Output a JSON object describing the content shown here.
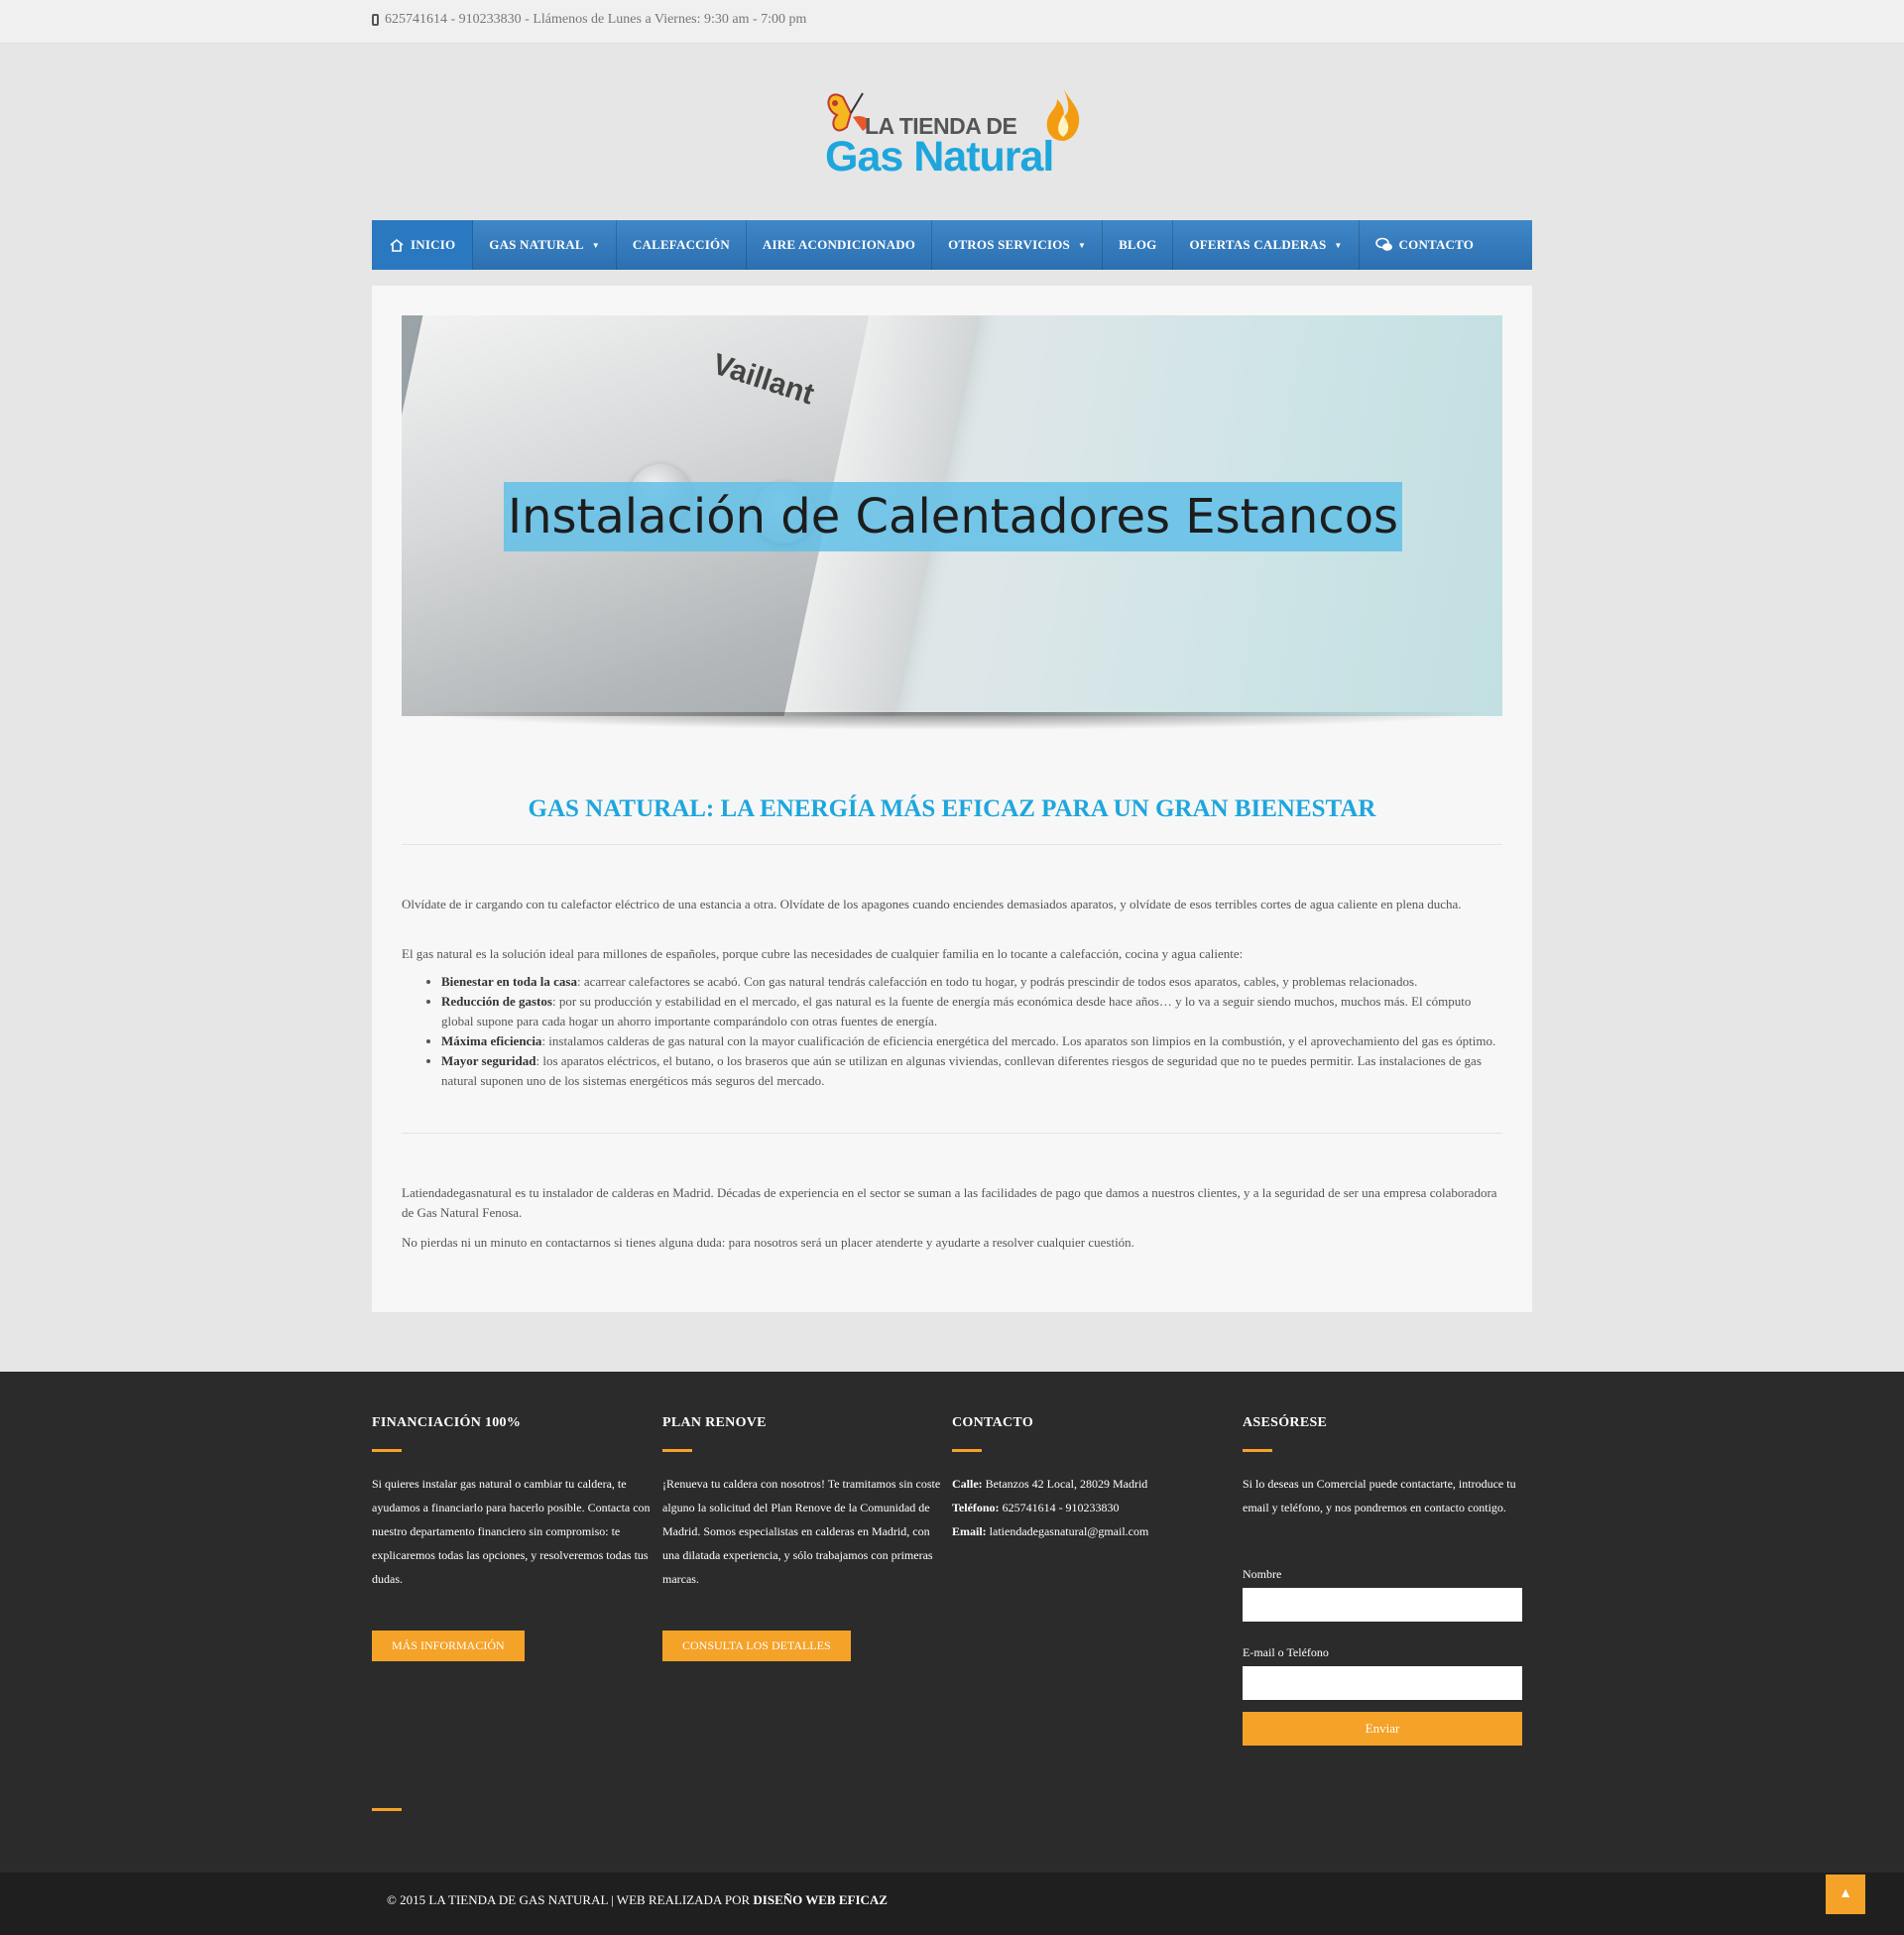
{
  "topbar": {
    "contact_text": "625741614 - 910233830 - Llámenos de Lunes a Viernes: 9:30 am - 7:00 pm"
  },
  "logo": {
    "line1": "LA TIENDA DE",
    "line2": "Gas Natural"
  },
  "nav": {
    "items": [
      {
        "label": "INICIO",
        "icon": "home-icon"
      },
      {
        "label": "GAS NATURAL",
        "dropdown": true
      },
      {
        "label": "CALEFACCIÓN"
      },
      {
        "label": "AIRE ACONDICIONADO"
      },
      {
        "label": "OTROS SERVICIOS",
        "dropdown": true
      },
      {
        "label": "BLOG"
      },
      {
        "label": "OFERTAS CALDERAS",
        "dropdown": true
      },
      {
        "label": "CONTACTO",
        "icon": "chat-icon"
      }
    ]
  },
  "hero": {
    "brand": "Vaillant",
    "banner_text": "Instalación de Calentadores Estancos"
  },
  "main": {
    "title": "GAS NATURAL: LA ENERGÍA MÁS EFICAZ PARA UN GRAN BIENESTAR",
    "intro1": "Olvídate de ir cargando con tu calefactor eléctrico de una estancia a otra. Olvídate de los apagones cuando enciendes demasiados aparatos, y olvídate de esos terribles cortes de agua caliente en plena ducha.",
    "intro2": "El gas natural es la solución ideal para millones de españoles, porque cubre las necesidades de cualquier familia en lo tocante a calefacción, cocina y agua caliente:",
    "benefits": [
      {
        "title": "Bienestar en toda la casa",
        "text": ": acarrear calefactores se acabó. Con gas natural tendrás calefacción en todo tu hogar, y podrás prescindir de todos esos aparatos, cables, y problemas relacionados."
      },
      {
        "title": "Reducción de gastos",
        "text": ": por su producción y estabilidad en el mercado, el gas natural es la fuente de energía más económica desde hace años… y lo va a seguir siendo muchos, muchos más. El cómputo global supone para cada hogar un ahorro importante comparándolo con otras fuentes de energía."
      },
      {
        "title": "Máxima eficiencia",
        "text": ": instalamos calderas de gas natural con la mayor cualificación de eficiencia energética del mercado. Los aparatos son limpios en la combustión, y el aprovechamiento del gas es óptimo."
      },
      {
        "title": "Mayor seguridad",
        "text": ": los aparatos eléctricos, el butano, o los braseros que aún se utilizan en algunas viviendas, conllevan diferentes riesgos de seguridad que no te puedes permitir. Las instalaciones de gas natural suponen uno de los sistemas energéticos más seguros del mercado."
      }
    ],
    "outro1": "Latiendadegasnatural es tu instalador de calderas en Madrid. Décadas de experiencia en el sector se suman a las facilidades de pago que damos a nuestros clientes, y a la seguridad de ser una empresa colaboradora de Gas Natural Fenosa.",
    "outro2": "No pierdas ni un minuto en contactarnos si tienes alguna duda: para nosotros será un placer atenderte y ayudarte a resolver cualquier cuestión."
  },
  "footer": {
    "col1": {
      "title": "FINANCIACIÓN 100%",
      "text": "Si quieres instalar gas natural o cambiar tu caldera, te ayudamos a financiarlo para hacerlo posible. Contacta con nuestro departamento financiero sin compromiso: te explicaremos todas las opciones, y resolveremos todas tus dudas.",
      "button": "MÁS INFORMACIÓN"
    },
    "col2": {
      "title": "PLAN RENOVE",
      "text": "¡Renueva tu caldera con nosotros! Te tramitamos sin coste alguno la solicitud del Plan Renove de la Comunidad de Madrid. Somos especialistas en calderas en Madrid, con una dilatada experiencia, y sólo trabajamos con primeras marcas.",
      "button": "CONSULTA LOS DETALLES"
    },
    "col3": {
      "title": "CONTACTO",
      "street_label": "Calle:",
      "street": " Betanzos 42 Local, 28029 Madrid",
      "phone_label": "Teléfono:",
      "phone": " 625741614 - 910233830",
      "email_label": "Email:",
      "email": " latiendadegasnatural@gmail.com"
    },
    "col4": {
      "title": "ASESÓRESE",
      "text": "Si lo deseas un Comercial puede contactarte, introduce tu email y teléfono, y nos pondremos en contacto contigo.",
      "name_label": "Nombre",
      "contact_label": "E-mail o Teléfono",
      "submit": "Enviar"
    },
    "copyright": "© 2015 LA TIENDA DE GAS NATURAL | WEB REALIZADA POR ",
    "credit": "DISEÑO WEB EFICAZ"
  },
  "colors": {
    "accent_blue": "#1ea6dd",
    "nav_blue": "#2c6fb1",
    "accent_orange": "#f5a228",
    "footer_bg": "#2b2b2b"
  }
}
